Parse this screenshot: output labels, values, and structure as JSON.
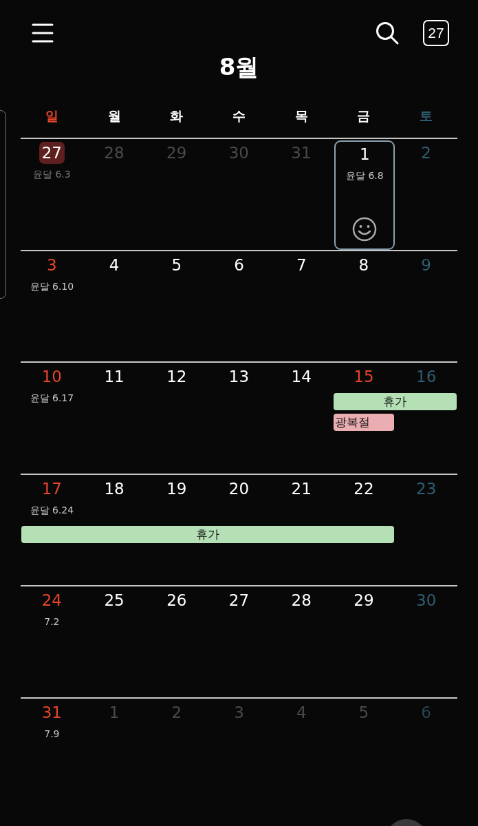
{
  "top_bar": {
    "today_badge": "27"
  },
  "title": "8월",
  "weekdays": [
    "일",
    "월",
    "화",
    "수",
    "목",
    "금",
    "토"
  ],
  "weeks": [
    {
      "days": [
        {
          "day": "27",
          "lunar": "윤달 6.3",
          "dim": true,
          "today": true,
          "selected": false
        },
        {
          "day": "28",
          "dim": true,
          "today": false,
          "selected": false
        },
        {
          "day": "29",
          "dim": true,
          "today": false,
          "selected": false
        },
        {
          "day": "30",
          "dim": true,
          "today": false,
          "selected": false
        },
        {
          "day": "31",
          "dim": true,
          "today": false,
          "selected": false
        },
        {
          "day": "1",
          "lunar": "윤달 6.8",
          "dim": false,
          "today": false,
          "selected": true
        },
        {
          "day": "2",
          "dim": false,
          "today": false,
          "selected": false
        }
      ]
    },
    {
      "days": [
        {
          "day": "3",
          "lunar": "윤달 6.10",
          "dim": false,
          "today": false,
          "selected": false
        },
        {
          "day": "4",
          "dim": false,
          "today": false,
          "selected": false
        },
        {
          "day": "5",
          "dim": false,
          "today": false,
          "selected": false
        },
        {
          "day": "6",
          "dim": false,
          "today": false,
          "selected": false
        },
        {
          "day": "7",
          "dim": false,
          "today": false,
          "selected": false
        },
        {
          "day": "8",
          "dim": false,
          "today": false,
          "selected": false
        },
        {
          "day": "9",
          "dim": false,
          "today": false,
          "selected": false
        }
      ]
    },
    {
      "days": [
        {
          "day": "10",
          "lunar": "윤달 6.17",
          "dim": false,
          "today": false,
          "selected": false
        },
        {
          "day": "11",
          "dim": false,
          "today": false,
          "selected": false
        },
        {
          "day": "12",
          "dim": false,
          "today": false,
          "selected": false
        },
        {
          "day": "13",
          "dim": false,
          "today": false,
          "selected": false
        },
        {
          "day": "14",
          "dim": false,
          "today": false,
          "selected": false
        },
        {
          "day": "15",
          "dim": false,
          "holiday": true,
          "today": false,
          "selected": false
        },
        {
          "day": "16",
          "dim": false,
          "today": false,
          "selected": false
        }
      ],
      "events": [
        {
          "label": "휴가",
          "color": "#b5e0b5"
        },
        {
          "label": "광복절",
          "color": "#eaaeb2"
        }
      ]
    },
    {
      "days": [
        {
          "day": "17",
          "lunar": "윤달 6.24",
          "dim": false,
          "today": false,
          "selected": false
        },
        {
          "day": "18",
          "dim": false,
          "today": false,
          "selected": false
        },
        {
          "day": "19",
          "dim": false,
          "today": false,
          "selected": false
        },
        {
          "day": "20",
          "dim": false,
          "today": false,
          "selected": false
        },
        {
          "day": "21",
          "dim": false,
          "today": false,
          "selected": false
        },
        {
          "day": "22",
          "dim": false,
          "today": false,
          "selected": false
        },
        {
          "day": "23",
          "dim": false,
          "today": false,
          "selected": false
        }
      ],
      "events": [
        {
          "label": "휴가",
          "color": "#b5e0b5"
        }
      ]
    },
    {
      "days": [
        {
          "day": "24",
          "lunar": "7.2",
          "dim": false,
          "today": false,
          "selected": false
        },
        {
          "day": "25",
          "dim": false,
          "today": false,
          "selected": false
        },
        {
          "day": "26",
          "dim": false,
          "today": false,
          "selected": false
        },
        {
          "day": "27",
          "dim": false,
          "today": false,
          "selected": false
        },
        {
          "day": "28",
          "dim": false,
          "today": false,
          "selected": false
        },
        {
          "day": "29",
          "dim": false,
          "today": false,
          "selected": false
        },
        {
          "day": "30",
          "dim": false,
          "today": false,
          "selected": false
        }
      ]
    },
    {
      "days": [
        {
          "day": "31",
          "lunar": "7.9",
          "dim": false,
          "today": false,
          "selected": false
        },
        {
          "day": "1",
          "dim": true,
          "today": false,
          "selected": false
        },
        {
          "day": "2",
          "dim": true,
          "today": false,
          "selected": false
        },
        {
          "day": "3",
          "dim": true,
          "today": false,
          "selected": false
        },
        {
          "day": "4",
          "dim": true,
          "today": false,
          "selected": false
        },
        {
          "day": "5",
          "dim": true,
          "today": false,
          "selected": false
        },
        {
          "day": "6",
          "dim": true,
          "today": false,
          "selected": false
        }
      ]
    }
  ]
}
